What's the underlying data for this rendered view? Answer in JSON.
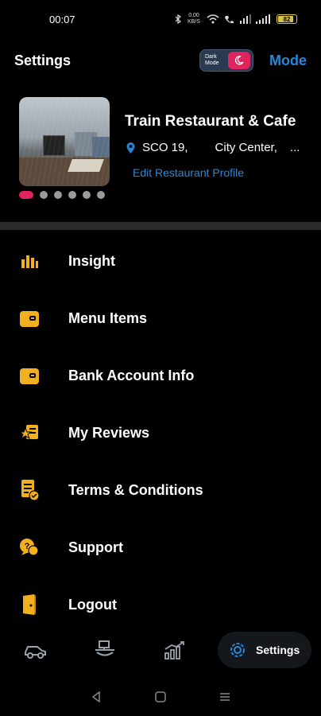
{
  "status_bar": {
    "time": "00:07",
    "network_speed": "0.00 KB/S",
    "battery_level": "82"
  },
  "header": {
    "title": "Settings",
    "toggle_label": "Dark Mode",
    "mode_label": "Mode"
  },
  "profile": {
    "restaurant_name": "Train Restaurant & Cafe",
    "address_part1": "SCO 19,",
    "address_part2": "City Center,",
    "address_more": "...",
    "edit_link": "Edit Restaurant Profile",
    "carousel_total": 6,
    "carousel_active": 1
  },
  "menu": {
    "items": [
      {
        "label": "Insight",
        "icon": "bar-chart-icon"
      },
      {
        "label": "Menu Items",
        "icon": "wallet-icon"
      },
      {
        "label": "Bank Account Info",
        "icon": "wallet-icon"
      },
      {
        "label": "My Reviews",
        "icon": "star-review-icon"
      },
      {
        "label": "Terms & Conditions",
        "icon": "document-check-icon"
      },
      {
        "label": "Support",
        "icon": "support-chat-icon"
      },
      {
        "label": "Logout",
        "icon": "door-exit-icon"
      }
    ]
  },
  "bottom_nav": {
    "settings_label": "Settings"
  },
  "colors": {
    "accent_yellow": "#f2b01e",
    "link_blue": "#2a86d8",
    "active_pink": "#e0245e",
    "background": "#000000"
  }
}
